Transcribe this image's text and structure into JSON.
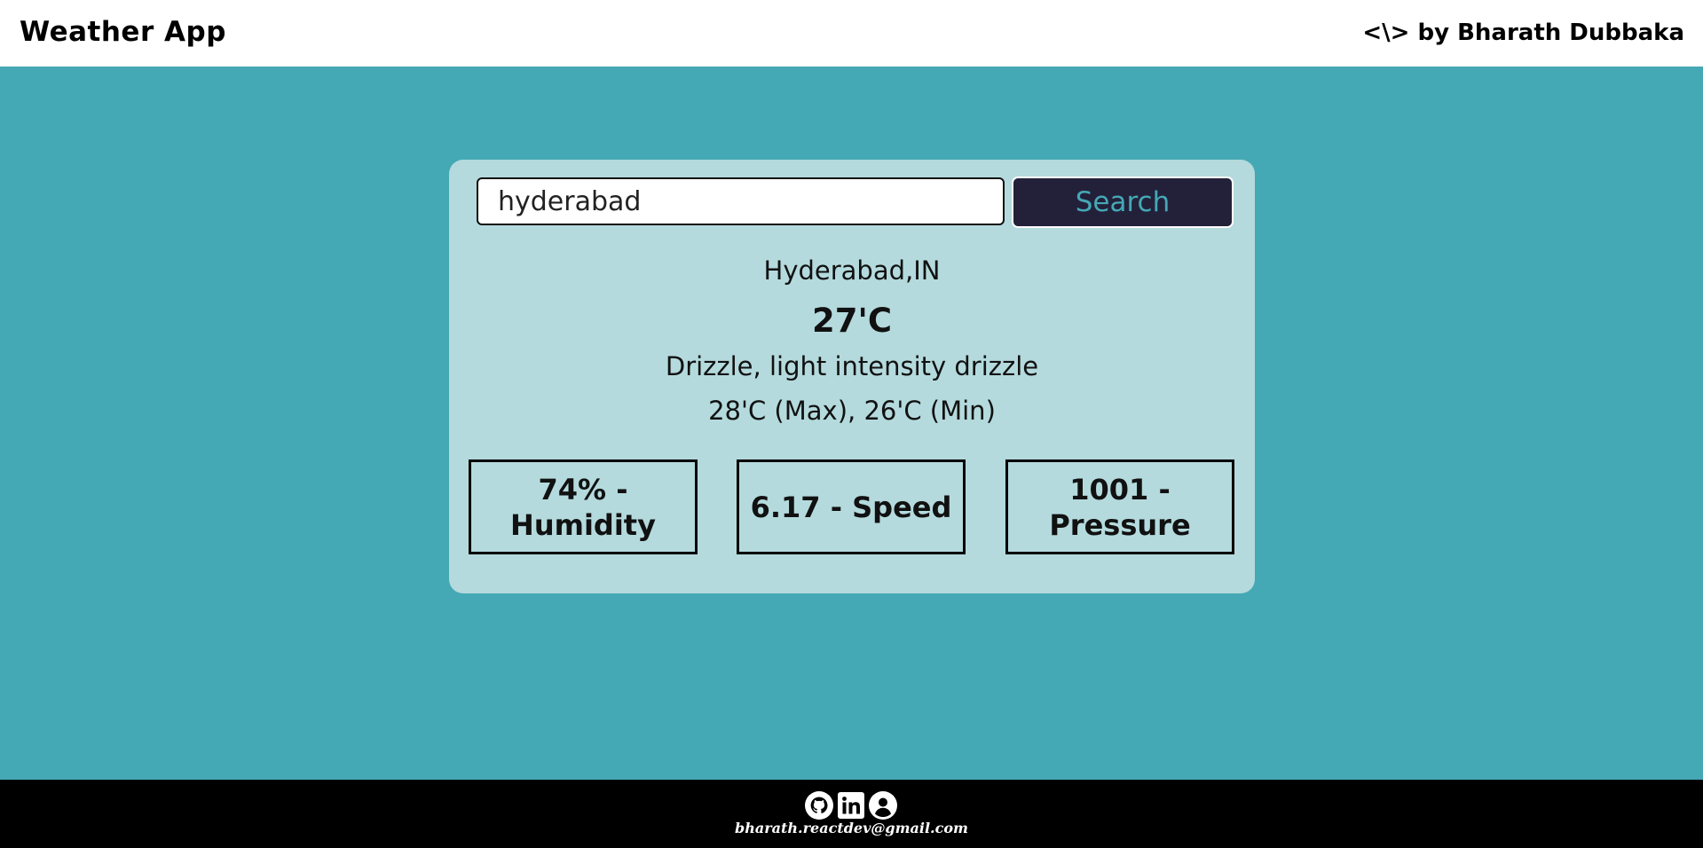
{
  "header": {
    "title": "Weather App",
    "author": "<\\> by Bharath Dubbaka"
  },
  "search": {
    "value": "hyderabad",
    "button_label": "Search"
  },
  "weather": {
    "location": "Hyderabad,IN",
    "temperature": "27'C",
    "description": "Drizzle, light intensity drizzle",
    "range": "28'C (Max), 26'C (Min)"
  },
  "stats": {
    "humidity": "74% - Humidity",
    "speed": "6.17 - Speed",
    "pressure": "1001 - Pressure"
  },
  "footer": {
    "icons": [
      "github-icon",
      "linkedin-icon",
      "user-icon"
    ],
    "email": "bharath.reactdev@gmail.com"
  },
  "colors": {
    "background": "#45a8b5",
    "card": "#b4dadd",
    "button": "#23213a",
    "button_text": "#45a8b5",
    "footer": "#000000"
  }
}
